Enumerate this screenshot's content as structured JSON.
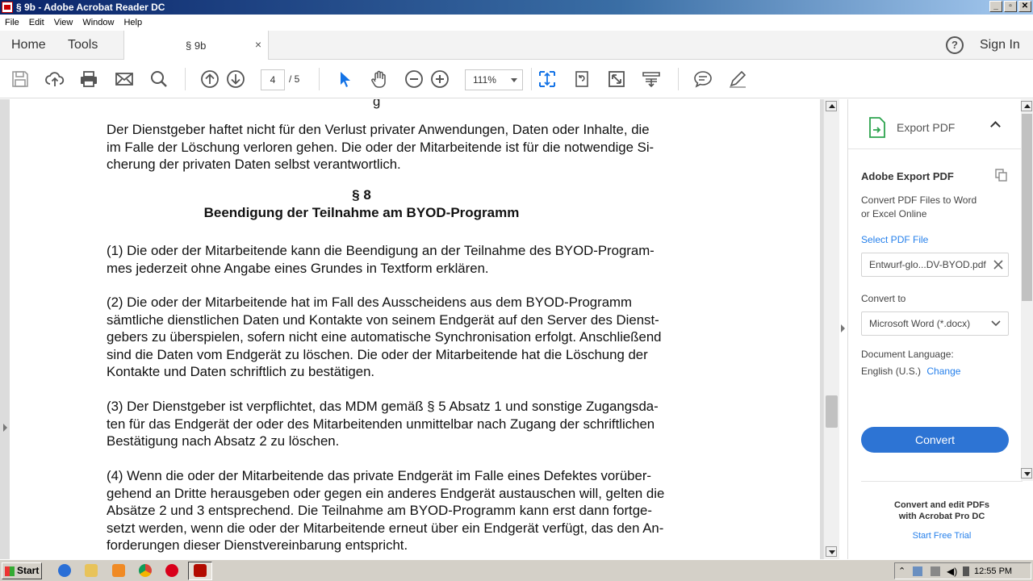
{
  "window": {
    "title": "§ 9b - Adobe Acrobat Reader DC",
    "buttons": [
      "_",
      "▫",
      "✕"
    ]
  },
  "menu": [
    "File",
    "Edit",
    "View",
    "Window",
    "Help"
  ],
  "tabs": {
    "home": "Home",
    "tools": "Tools",
    "document": "§ 9b",
    "close": "×",
    "help": "?",
    "sign_in": "Sign In"
  },
  "toolbar": {
    "icons": [
      "save-icon",
      "upload-icon",
      "print-icon",
      "mail-icon",
      "search-icon",
      "page-up-icon",
      "page-down-icon",
      "select-icon",
      "hand-icon",
      "zoom-out-icon",
      "zoom-in-icon",
      "fit-icon",
      "rotate-icon",
      "fullscreen-icon",
      "scroll-icon",
      "comment-icon",
      "sign-icon"
    ],
    "page_current": "4",
    "page_total": "/ 5",
    "zoom": "111%"
  },
  "document": {
    "partial_line": "g",
    "para0": "Der Dienstgeber haftet nicht für den Verlust privater Anwendungen, Daten oder Inhalte, die\nim Falle der Löschung verloren gehen. Die oder der Mitarbeitende ist für die notwendige Si-\ncherung der privaten Daten selbst verantwortlich.",
    "section": "§ 8",
    "section_title": "Beendigung der Teilnahme am BYOD-Programm",
    "para1": "(1) Die oder der Mitarbeitende kann die Beendigung an der Teilnahme des BYOD-Program-\nmes jederzeit ohne Angabe eines Grundes in Textform erklären.",
    "para2": "(2) Die oder der Mitarbeitende hat im Fall des Ausscheidens aus dem BYOD-Programm\nsämtliche dienstlichen Daten und Kontakte von seinem Endgerät auf den Server des Dienst-\ngebers zu überspielen, sofern nicht eine automatische Synchronisation erfolgt. Anschließend\nsind die Daten vom Endgerät zu löschen. Die oder der Mitarbeitende hat die Löschung der\nKontakte und Daten schriftlich zu bestätigen.",
    "para3": "(3) Der Dienstgeber ist verpflichtet, das MDM gemäß § 5 Absatz 1 und sonstige Zugangsda-\nten für das Endgerät der oder des Mitarbeitenden unmittelbar nach Zugang der schriftlichen\nBestätigung nach Absatz 2 zu löschen.",
    "para4": "(4) Wenn die oder der Mitarbeitende das private Endgerät im Falle eines Defektes vorüber-\ngehend an Dritte herausgeben oder gegen ein anderes Endgerät austauschen will, gelten die\nAbsätze 2 und 3 entsprechend. Die Teilnahme am BYOD-Programm kann erst dann fortge-\nsetzt werden, wenn die oder der Mitarbeitende erneut über ein Endgerät verfügt, das den An-\nforderungen dieser Dienstvereinbarung entspricht."
  },
  "export_panel": {
    "header": "Export PDF",
    "title": "Adobe Export PDF",
    "description": "Convert PDF Files to Word\nor Excel Online",
    "select_label": "Select PDF File",
    "file_name": "Entwurf-glo...DV-BYOD.pdf",
    "convert_to_label": "Convert to",
    "convert_to_value": "Microsoft Word (*.docx)",
    "language_label": "Document Language:",
    "language_value": "English (U.S.)",
    "change_link": "Change",
    "convert_button": "Convert",
    "promo_text": "Convert and edit PDFs\nwith Acrobat Pro DC",
    "promo_link": "Start Free Trial"
  },
  "taskbar": {
    "start": "Start",
    "clock": "12:55 PM"
  },
  "colors": {
    "accent": "#2d74d4",
    "link": "#2680eb",
    "titlebar": "#0a246a"
  }
}
